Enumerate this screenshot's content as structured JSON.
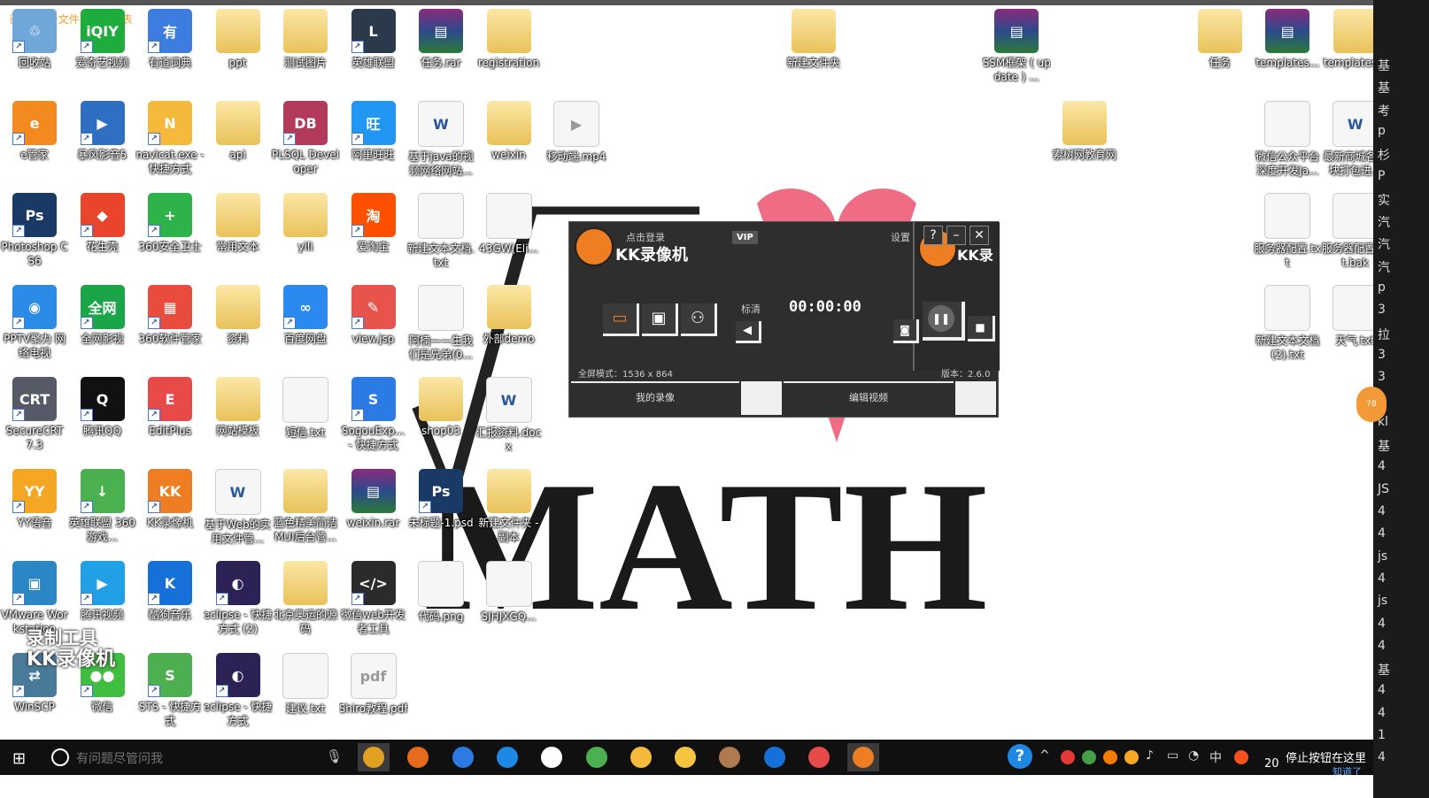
{
  "notice": "已添加1个文件到播放列表",
  "wallpaper": {
    "word": "MATH",
    "heart_color": "#f06c84"
  },
  "watermark": {
    "line1": "录制工具",
    "line2": "KK录像机"
  },
  "desktop_icons": [
    {
      "label": "回收站",
      "kind": "app",
      "color": "#6ea7d8",
      "glyph": "♲"
    },
    {
      "label": "爱奇艺视频",
      "kind": "app",
      "color": "#1ead3c",
      "glyph": "iQIY"
    },
    {
      "label": "有道词典",
      "kind": "app",
      "color": "#3d7de0",
      "glyph": "有"
    },
    {
      "label": "ppt",
      "kind": "folder",
      "glyph": ""
    },
    {
      "label": "测试图片",
      "kind": "folder",
      "glyph": ""
    },
    {
      "label": "英雄联盟",
      "kind": "app",
      "color": "#2a3a4a",
      "glyph": "L"
    },
    {
      "label": "任务.rar",
      "kind": "rar",
      "glyph": "▤"
    },
    {
      "label": "registration",
      "kind": "folder",
      "glyph": ""
    },
    {
      "label": "新建文件夹",
      "kind": "folder",
      "glyph": ""
    },
    {
      "label": "SSM框架 ( update ) ...",
      "kind": "rar",
      "glyph": "▤"
    },
    {
      "label": "任务",
      "kind": "folder",
      "glyph": ""
    },
    {
      "label": "templates...",
      "kind": "rar",
      "glyph": "▤"
    },
    {
      "label": "templates...",
      "kind": "folder",
      "glyph": ""
    },
    {
      "label": "e管家",
      "kind": "app",
      "color": "#f28a20",
      "glyph": "e"
    },
    {
      "label": "暴风影音5",
      "kind": "app",
      "color": "#2f6fc3",
      "glyph": "▶"
    },
    {
      "label": "navicat.exe - 快捷方式",
      "kind": "app",
      "color": "#f5b93b",
      "glyph": "N"
    },
    {
      "label": "api",
      "kind": "folder",
      "glyph": ""
    },
    {
      "label": "PLSQL Developer",
      "kind": "app",
      "color": "#b23a5a",
      "glyph": "DB"
    },
    {
      "label": "阿里旺旺",
      "kind": "app",
      "color": "#2196f3",
      "glyph": "旺"
    },
    {
      "label": "基于java的视频网络网站...",
      "kind": "word",
      "glyph": "W"
    },
    {
      "label": "weixin",
      "kind": "folder",
      "glyph": ""
    },
    {
      "label": "移动端.mp4",
      "kind": "file",
      "glyph": "▶"
    },
    {
      "label": "索树网教育网",
      "kind": "folder",
      "glyph": ""
    },
    {
      "label": "微信公众平台深度开发Ja...",
      "kind": "file",
      "glyph": ""
    },
    {
      "label": "最新商城各模块打包进...",
      "kind": "word",
      "glyph": "W"
    },
    {
      "label": "Photoshop CS6",
      "kind": "app",
      "color": "#1a3a66",
      "glyph": "Ps"
    },
    {
      "label": "花生壳",
      "kind": "app",
      "color": "#e8452c",
      "glyph": "◆"
    },
    {
      "label": "360安全卫士",
      "kind": "app",
      "color": "#2db34a",
      "glyph": "+"
    },
    {
      "label": "常用文本",
      "kind": "folder",
      "glyph": ""
    },
    {
      "label": "yili",
      "kind": "folder",
      "glyph": ""
    },
    {
      "label": "爱淘宝",
      "kind": "app",
      "color": "#ff5000",
      "glyph": "淘"
    },
    {
      "label": "新建文本文档.txt",
      "kind": "file",
      "glyph": ""
    },
    {
      "label": "43GW(Eli...",
      "kind": "file",
      "glyph": ""
    },
    {
      "label": "服务器配置.txt",
      "kind": "file",
      "glyph": ""
    },
    {
      "label": "服务器配置.txt.bak",
      "kind": "file",
      "glyph": ""
    },
    {
      "label": "PPTV聚力 网络电视",
      "kind": "app",
      "color": "#2a8ce6",
      "glyph": "◉"
    },
    {
      "label": "全网影视",
      "kind": "app",
      "color": "#1aa548",
      "glyph": "全网"
    },
    {
      "label": "360软件管家",
      "kind": "app",
      "color": "#e84c3d",
      "glyph": "▦"
    },
    {
      "label": "资料",
      "kind": "folder",
      "glyph": ""
    },
    {
      "label": "百度网盘",
      "kind": "app",
      "color": "#2b8af0",
      "glyph": "∞"
    },
    {
      "label": "view.jsp",
      "kind": "app",
      "color": "#e8534b",
      "glyph": "✎"
    },
    {
      "label": "阿楠——生我们是兄弟(0...",
      "kind": "file",
      "glyph": ""
    },
    {
      "label": "外部demo",
      "kind": "folder",
      "glyph": ""
    },
    {
      "label": "新建文本文档 (2).txt",
      "kind": "file",
      "glyph": ""
    },
    {
      "label": "天气.txt",
      "kind": "file",
      "glyph": ""
    },
    {
      "label": "SecureCRT 7.3",
      "kind": "app",
      "color": "#555a66",
      "glyph": "CRT"
    },
    {
      "label": "腾讯QQ",
      "kind": "app",
      "color": "#111111",
      "glyph": "Q"
    },
    {
      "label": "EditPlus",
      "kind": "app",
      "color": "#e84a4a",
      "glyph": "E"
    },
    {
      "label": "网站模板",
      "kind": "folder",
      "glyph": ""
    },
    {
      "label": "短信.txt",
      "kind": "file",
      "glyph": ""
    },
    {
      "label": "SogouExp... - 快捷方式",
      "kind": "app",
      "color": "#2c7be5",
      "glyph": "S"
    },
    {
      "label": "shop03",
      "kind": "folder",
      "glyph": ""
    },
    {
      "label": "汇报资料.docx",
      "kind": "word",
      "glyph": "W"
    },
    {
      "label": "YY语音",
      "kind": "app",
      "color": "#f5a623",
      "glyph": "YY"
    },
    {
      "label": "英雄联盟 360游戏...",
      "kind": "app",
      "color": "#4bb04f",
      "glyph": "↓"
    },
    {
      "label": "KK录像机",
      "kind": "app",
      "color": "#ef7d22",
      "glyph": "KK"
    },
    {
      "label": "基于Web的实用文件管...",
      "kind": "word",
      "glyph": "W"
    },
    {
      "label": "蓝色精美简洁MUI后台管...",
      "kind": "folder",
      "glyph": ""
    },
    {
      "label": "weixin.rar",
      "kind": "rar",
      "glyph": "▤"
    },
    {
      "label": "未标题-1.psd",
      "kind": "app",
      "color": "#1a3a66",
      "glyph": "Ps"
    },
    {
      "label": "新建文件夹 - 副本",
      "kind": "folder",
      "glyph": ""
    },
    {
      "label": "VMware Workstation",
      "kind": "app",
      "color": "#2b86c5",
      "glyph": "▣"
    },
    {
      "label": "腾讯视频",
      "kind": "app",
      "color": "#21a0e8",
      "glyph": "▶"
    },
    {
      "label": "酷狗音乐",
      "kind": "app",
      "color": "#1571d9",
      "glyph": "K"
    },
    {
      "label": "eclipse - 快捷方式 (2)",
      "kind": "app",
      "color": "#2c2255",
      "glyph": "◐"
    },
    {
      "label": "北京奥运的源码",
      "kind": "folder",
      "glyph": ""
    },
    {
      "label": "微信web开发者工具",
      "kind": "app",
      "color": "#2b2b2b",
      "glyph": "</>"
    },
    {
      "label": "代码.png",
      "kind": "file",
      "glyph": ""
    },
    {
      "label": "SJHJXGQ...",
      "kind": "file",
      "glyph": ""
    },
    {
      "label": "WinSCP",
      "kind": "app",
      "color": "#4a7a9a",
      "glyph": "⇄"
    },
    {
      "label": "微信",
      "kind": "app",
      "color": "#3fbe3f",
      "glyph": "●●"
    },
    {
      "label": "STS - 快捷方式",
      "kind": "app",
      "color": "#4caf50",
      "glyph": "S"
    },
    {
      "label": "eclipse - 快捷方式",
      "kind": "app",
      "color": "#2c2255",
      "glyph": "◐"
    },
    {
      "label": "建议.txt",
      "kind": "file",
      "glyph": ""
    },
    {
      "label": "Shiro教程.pdf",
      "kind": "file",
      "glyph": "pdf"
    }
  ],
  "recorder": {
    "login": "点击登录",
    "title": "KK录像机",
    "vip": "VIP",
    "settings": "设置",
    "help": "?",
    "minimize": "–",
    "close": "✕",
    "side_title": "KK录",
    "quality": "标清",
    "timer": "00:00:00",
    "fullscreen_mode": "全屏模式：1536 x 864",
    "version": "版本：2.6.0",
    "tab_my_recordings": "我的录像",
    "tab_edit_video": "编辑视频"
  },
  "right_strip_items": [
    "基",
    "基",
    "考",
    "p",
    "杉",
    "P",
    "实",
    "汽",
    "汽",
    "汽",
    "p",
    "3",
    "拉",
    "3",
    "3",
    "3",
    "kl",
    "基",
    "4",
    "JS",
    "4",
    "4",
    "js",
    "4",
    "js",
    "4",
    "4",
    "基",
    "4",
    "4",
    "1",
    "4"
  ],
  "orange_badge": "78",
  "taskbar": {
    "search_placeholder": "有问题尽管问我",
    "apps": [
      {
        "name": "chrome",
        "color": "#e0a020",
        "active": true
      },
      {
        "name": "firefox",
        "color": "#e76b1d",
        "active": false
      },
      {
        "name": "sogou",
        "color": "#2c7be5",
        "active": false
      },
      {
        "name": "edge",
        "color": "#1e88e5",
        "active": false
      },
      {
        "name": "store",
        "color": "#ffffff",
        "active": false
      },
      {
        "name": "sts",
        "color": "#4caf50",
        "active": false
      },
      {
        "name": "navicat",
        "color": "#f5b93b",
        "active": false
      },
      {
        "name": "explorer",
        "color": "#f5c542",
        "active": false
      },
      {
        "name": "image",
        "color": "#b07a50",
        "active": false
      },
      {
        "name": "kugou",
        "color": "#1571d9",
        "active": false
      },
      {
        "name": "editplus",
        "color": "#e84a4a",
        "active": false
      },
      {
        "name": "kk-recorder",
        "color": "#ef7d22",
        "active": true
      }
    ],
    "tray_text": "中",
    "ime": "^",
    "clock": "20",
    "message": "停止按钮在这里",
    "message_link": "知道了"
  }
}
